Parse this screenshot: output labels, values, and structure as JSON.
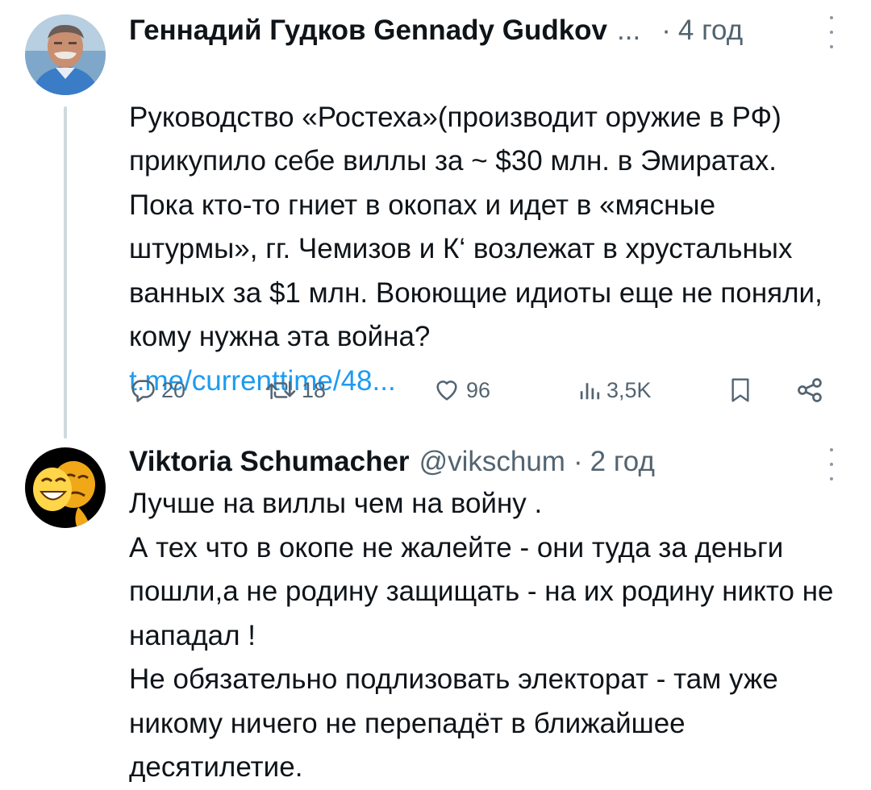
{
  "tweets": [
    {
      "author_name": "Геннадий Гудков Gennady Gudkov",
      "ellipsis": "...",
      "separator": "·",
      "time": "4 год",
      "text": "Руководство «Ростеха»(производит оружие в РФ) прикупило себе виллы за ~ $30 млн. в Эмиратах. Пока кто-то гниет в окопах и идет в «мясные штурмы», гг. Чемизов и К‘ возлежат в хрустальных ванных за $1 млн. Воюющие идиоты еще не поняли, кому нужна эта война?",
      "link": "t.me/currenttime/48...",
      "replies": "20",
      "reposts": "18",
      "likes": "96",
      "views": "3,5K",
      "avatar_icon": "user-photo"
    },
    {
      "author_name": "Viktoria Schumacher",
      "handle": "@vikschum",
      "separator": "·",
      "time": "2 год",
      "text": "Лучше на виллы чем на войну .\nА тех что в окопе не жалейте - они туда за деньги пошли,а не родину защищать - на их родину никто не нападал !\nНе обязательно подлизовать электорат - там уже никому ничего не перепадёт в ближайшее десятилетие.",
      "avatar_icon": "masks-emoji"
    }
  ],
  "icons": {
    "reply": "reply-icon",
    "repost": "repost-icon",
    "like": "like-icon",
    "views": "views-icon",
    "bookmark": "bookmark-icon",
    "share": "share-icon",
    "more": "more-icon"
  },
  "colors": {
    "text": "#0f1419",
    "muted": "#536471",
    "link": "#1d9bf0",
    "thread_line": "#cfd9de"
  }
}
